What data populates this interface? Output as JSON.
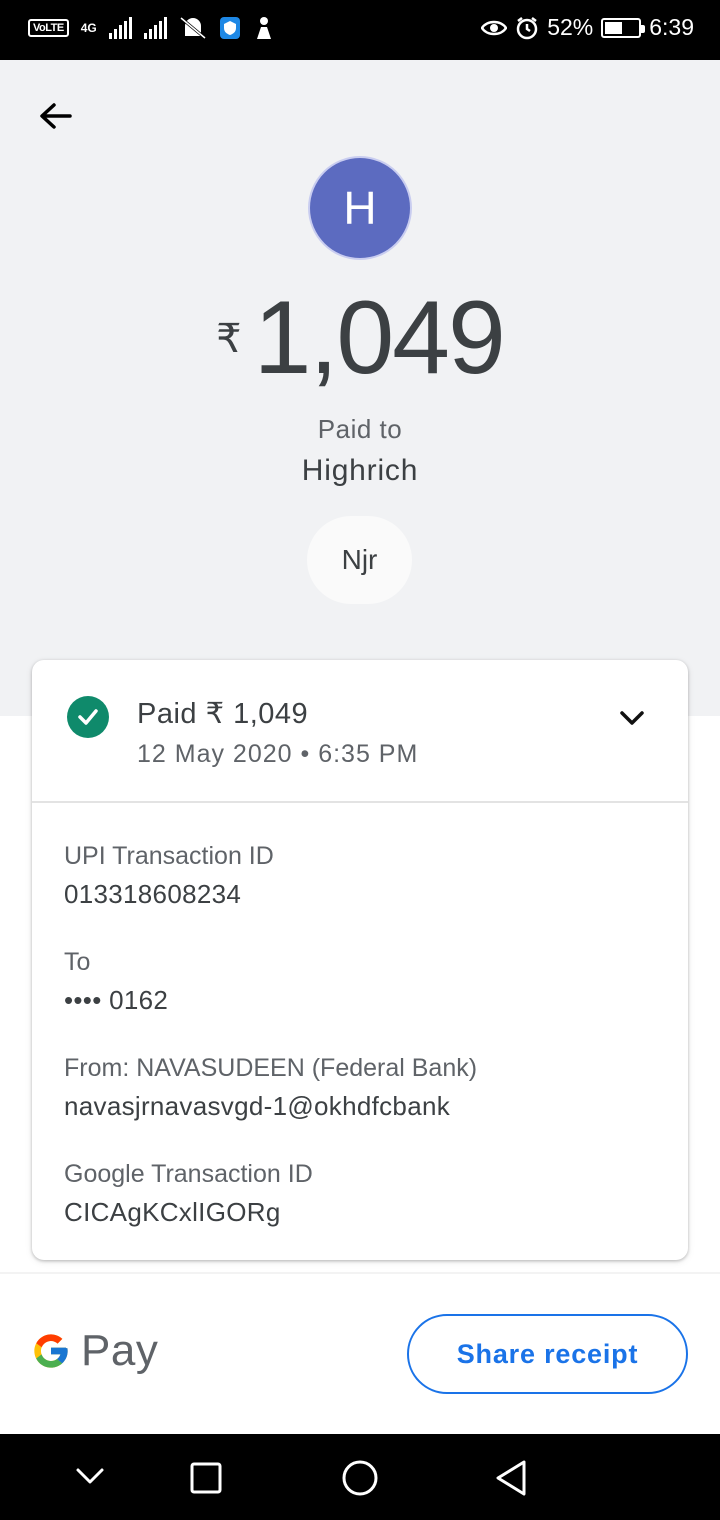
{
  "status_bar": {
    "volte": "VoLTE",
    "network": "4G",
    "battery": "52%",
    "battery_level": 0.52,
    "time": "6:39"
  },
  "payment": {
    "avatar_initial": "H",
    "currency": "₹",
    "amount": "1,049",
    "paid_to_label": "Paid to",
    "payee": "Highrich",
    "note": "Njr"
  },
  "card": {
    "status": "Paid ₹ 1,049",
    "date": "12 May 2020 • 6:35 PM",
    "details": [
      {
        "label": "UPI Transaction ID",
        "value": "013318608234"
      },
      {
        "label": "To",
        "value": "•••• 0162"
      },
      {
        "label": "From: NAVASUDEEN (Federal Bank)",
        "value": "navasjrnavasvgd-1@okhdfcbank"
      },
      {
        "label": "Google Transaction ID",
        "value": "CICAgKCxlIGORg"
      }
    ]
  },
  "footer": {
    "brand": "Pay",
    "share_label": "Share receipt"
  },
  "colors": {
    "accent": "#1a73e8",
    "avatar": "#5c6bc0",
    "success": "#0f8a6b",
    "background": "#f1f2f4"
  },
  "icons": [
    "back-arrow-icon",
    "check-circle-icon",
    "chevron-down-icon",
    "google-g-icon",
    "nav-back-icon",
    "nav-home-icon",
    "nav-recents-icon",
    "nav-collapse-icon"
  ]
}
